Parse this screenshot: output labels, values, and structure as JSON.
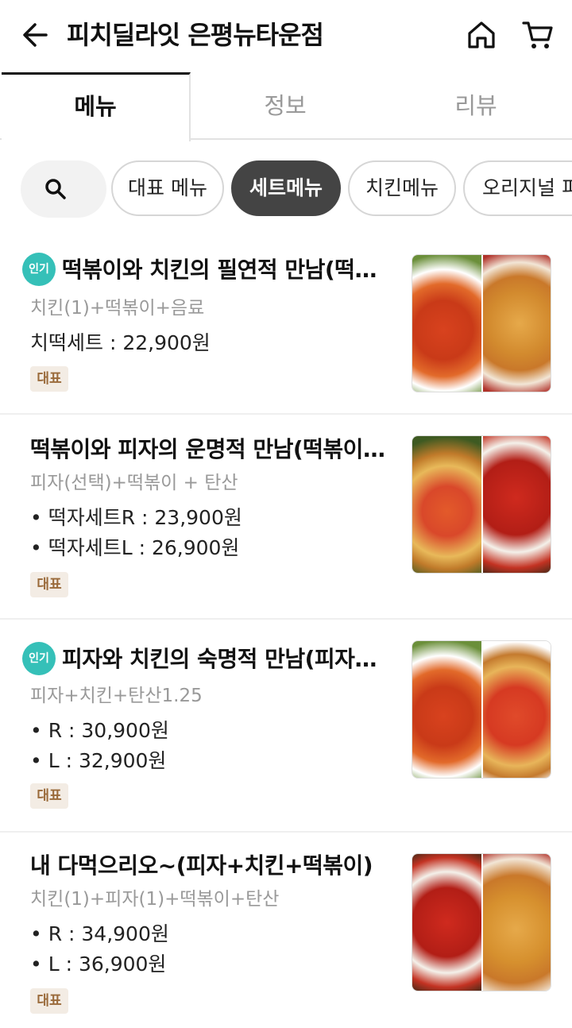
{
  "header": {
    "title": "피치딜라잇 은평뉴타운점",
    "back_icon": "back-arrow-icon",
    "home_icon": "home-icon",
    "cart_icon": "cart-icon"
  },
  "tabs": [
    {
      "label": "메뉴"
    },
    {
      "label": "정보"
    },
    {
      "label": "리뷰"
    }
  ],
  "chips": [
    {
      "label": "대표 메뉴"
    },
    {
      "label": "세트메뉴"
    },
    {
      "label": "치킨메뉴"
    },
    {
      "label": "오리지널 피"
    }
  ],
  "items": [
    {
      "badge": "인기",
      "name": "떡볶이와 치킨의 필연적 만남(떡볶이세트)",
      "desc": "치킨(1)+떡볶이+음료",
      "prices": [
        "치떡세트 : 22,900원"
      ],
      "tag": "대표"
    },
    {
      "name": "떡볶이와 피자의 운명적 만남(떡볶이세트)",
      "desc": "피자(선택)+떡볶이 + 탄산",
      "prices": [
        "• 떡자세트R : 23,900원",
        "• 떡자세트L : 26,900원"
      ],
      "tag": "대표"
    },
    {
      "badge": "인기",
      "name": "피자와 치킨의 숙명적 만남(피자치킨세트)",
      "desc": "피자+치킨+탄산1.25",
      "prices": [
        "• R : 30,900원",
        "• L : 32,900원"
      ],
      "tag": "대표"
    },
    {
      "name": "내 다먹으리오~(피자+치킨+떡볶이)",
      "desc": "치킨(1)+피자(1)+떡볶이+탄산",
      "prices": [
        "• R : 34,900원",
        "• L : 36,900원"
      ],
      "tag": "대표"
    }
  ],
  "colors": {
    "accent_badge": "#35c0b8",
    "tag_bg": "#f3ece4",
    "tag_text": "#9a6a3a",
    "chip_active": "#444444"
  }
}
